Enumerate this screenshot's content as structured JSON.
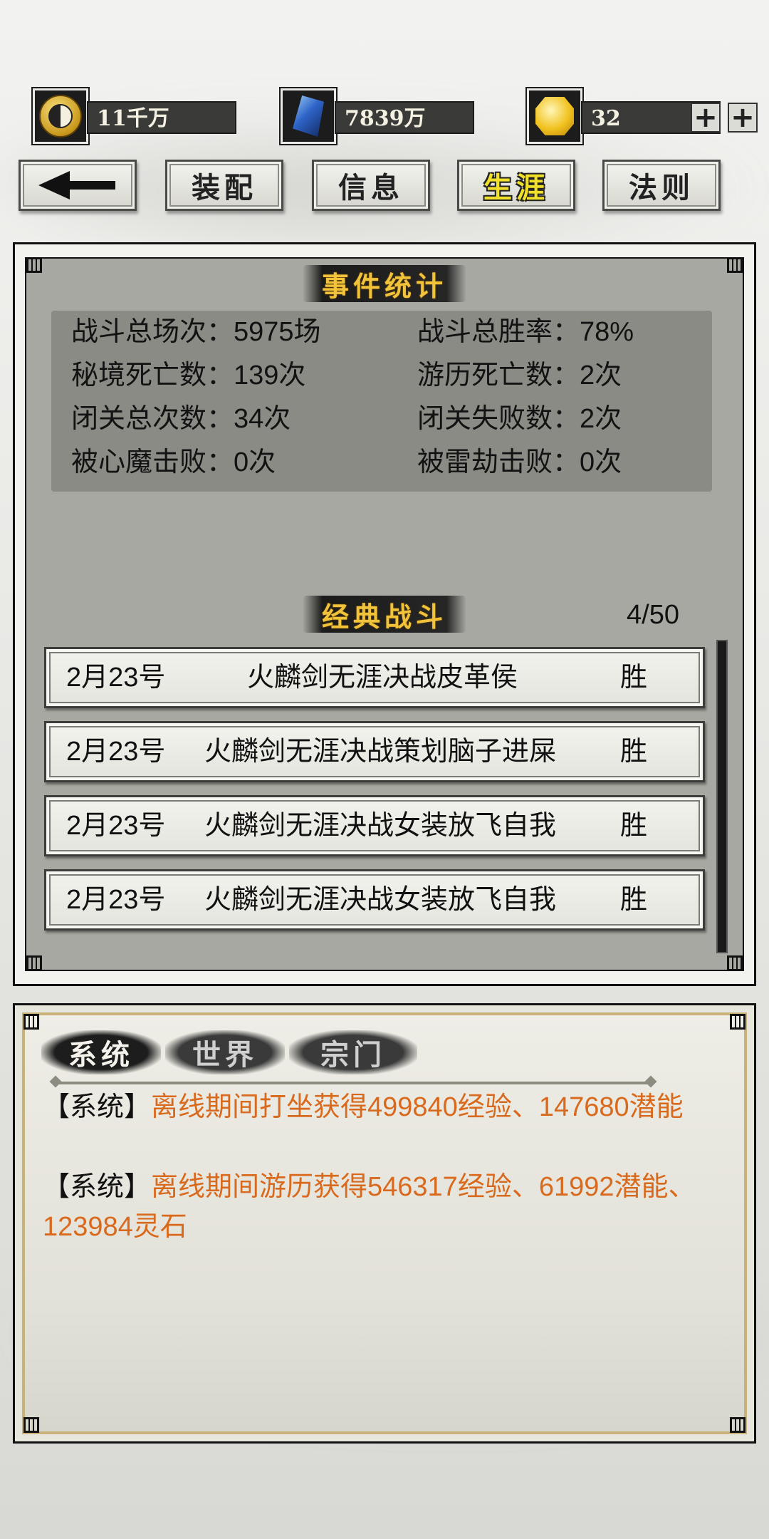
{
  "currency": [
    {
      "icon": "yinyang-coin-icon",
      "value": "11千万",
      "has_plus": false
    },
    {
      "icon": "blue-crystal-icon",
      "value": "7839万",
      "has_plus": true
    },
    {
      "icon": "gold-gem-icon",
      "value": "32",
      "has_plus": true
    }
  ],
  "tabs": {
    "back_icon": "back-arrow-icon",
    "items": [
      "装配",
      "信息",
      "生涯",
      "法则"
    ],
    "active": "生涯"
  },
  "event_stats": {
    "title": "事件统计",
    "rows": [
      [
        "战斗总场次：5975场",
        "战斗总胜率：78%"
      ],
      [
        "秘境死亡数：139次",
        "游历死亡数：2次"
      ],
      [
        "闭关总次数：34次",
        "闭关失败数：2次"
      ],
      [
        "被心魔击败：0次",
        "被雷劫击败：0次"
      ]
    ]
  },
  "classic_battles": {
    "title": "经典战斗",
    "page": "4/50",
    "items": [
      {
        "date": "2月23号",
        "desc": "火麟剑无涯决战皮革侯",
        "result": "胜"
      },
      {
        "date": "2月23号",
        "desc": "火麟剑无涯决战策划脑子进屎",
        "result": "胜"
      },
      {
        "date": "2月23号",
        "desc": "火麟剑无涯决战女装放飞自我",
        "result": "胜"
      },
      {
        "date": "2月23号",
        "desc": "火麟剑无涯决战女装放飞自我",
        "result": "胜"
      }
    ]
  },
  "chat": {
    "tabs": [
      "系统",
      "世界",
      "宗门"
    ],
    "messages": [
      {
        "tag": "【系统】",
        "text": "离线期间打坐获得499840经验、147680潜能"
      },
      {
        "tag": "【系统】",
        "text": "离线期间游历获得546317经验、61992潜能、123984灵石"
      }
    ]
  },
  "colors": {
    "accent_gold": "#f1c33a",
    "active_tab": "#f1e02a",
    "chat_orange": "#d96a1d"
  }
}
